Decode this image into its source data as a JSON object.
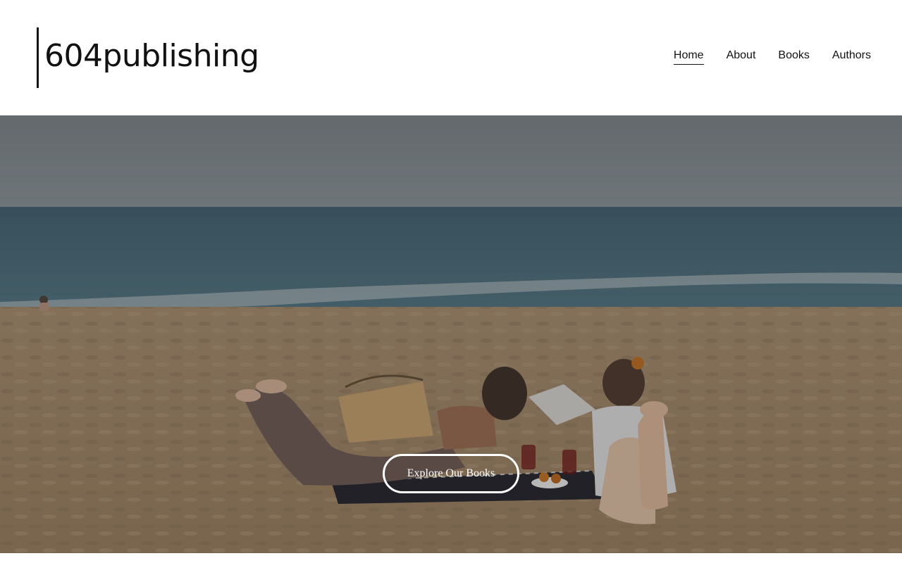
{
  "brand": {
    "name": "604publishing"
  },
  "nav": {
    "items": [
      {
        "label": "Home",
        "active": true
      },
      {
        "label": "About",
        "active": false
      },
      {
        "label": "Books",
        "active": false
      },
      {
        "label": "Authors",
        "active": false
      }
    ]
  },
  "hero": {
    "image": "beach-reading-photo",
    "cta_label": "Explore Our Books"
  },
  "colors": {
    "text": "#111111",
    "background": "#ffffff",
    "cta_border": "#ffffff"
  }
}
